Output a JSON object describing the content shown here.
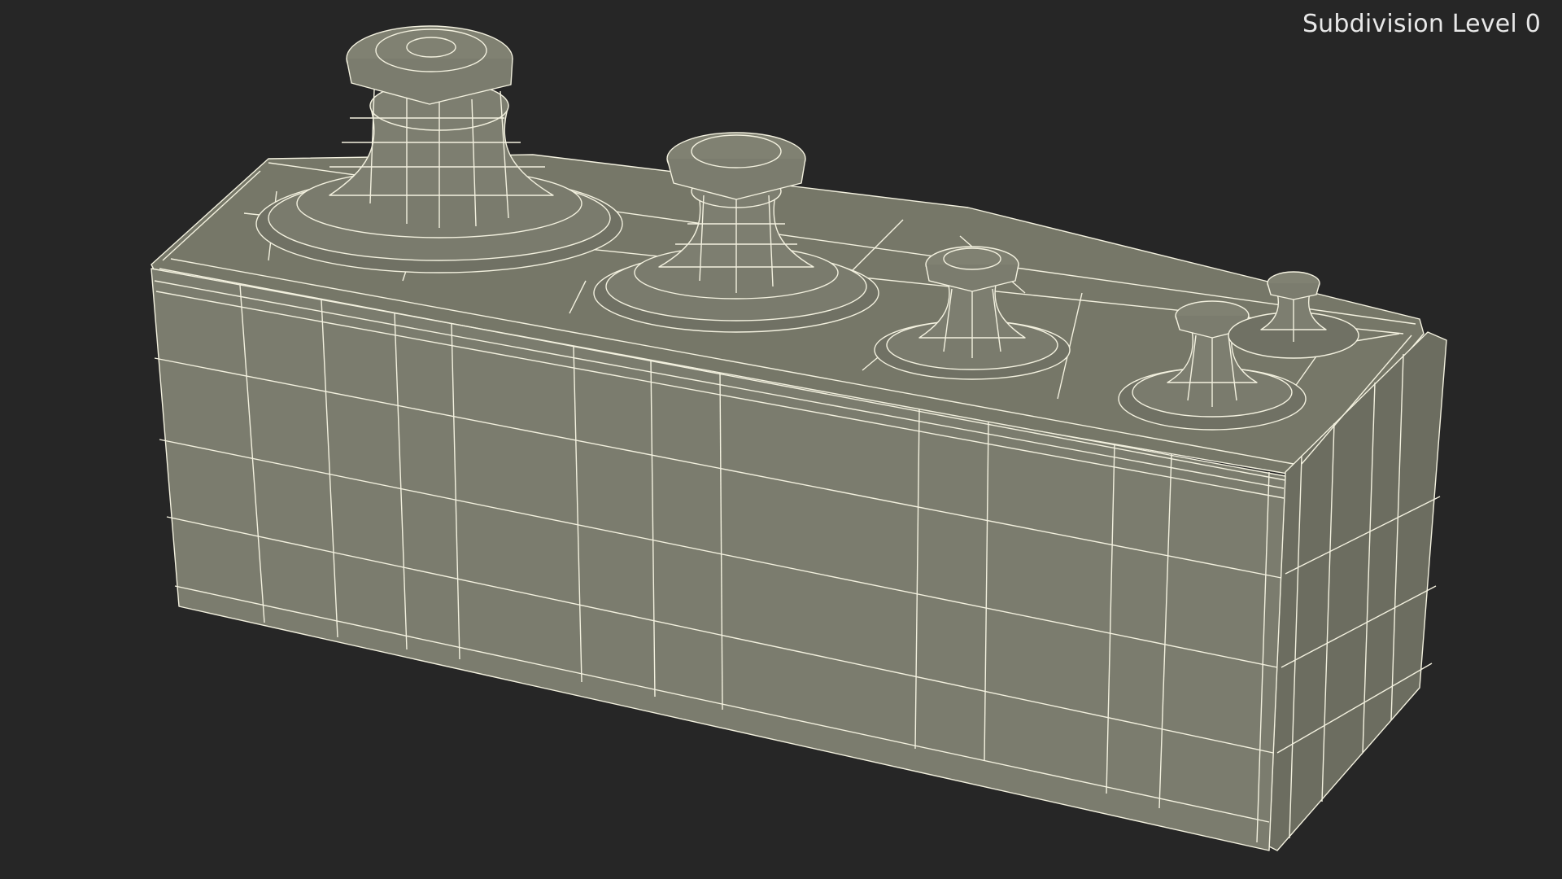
{
  "overlay": {
    "subdivision_label": "Subdivision Level 0"
  },
  "model": {
    "description_icon": "wireframe-box-model",
    "fill_color": "#7a7b6d",
    "fill_shade": "#6e6f62",
    "wire_color": "#f3f1df",
    "background_color": "#262626"
  }
}
